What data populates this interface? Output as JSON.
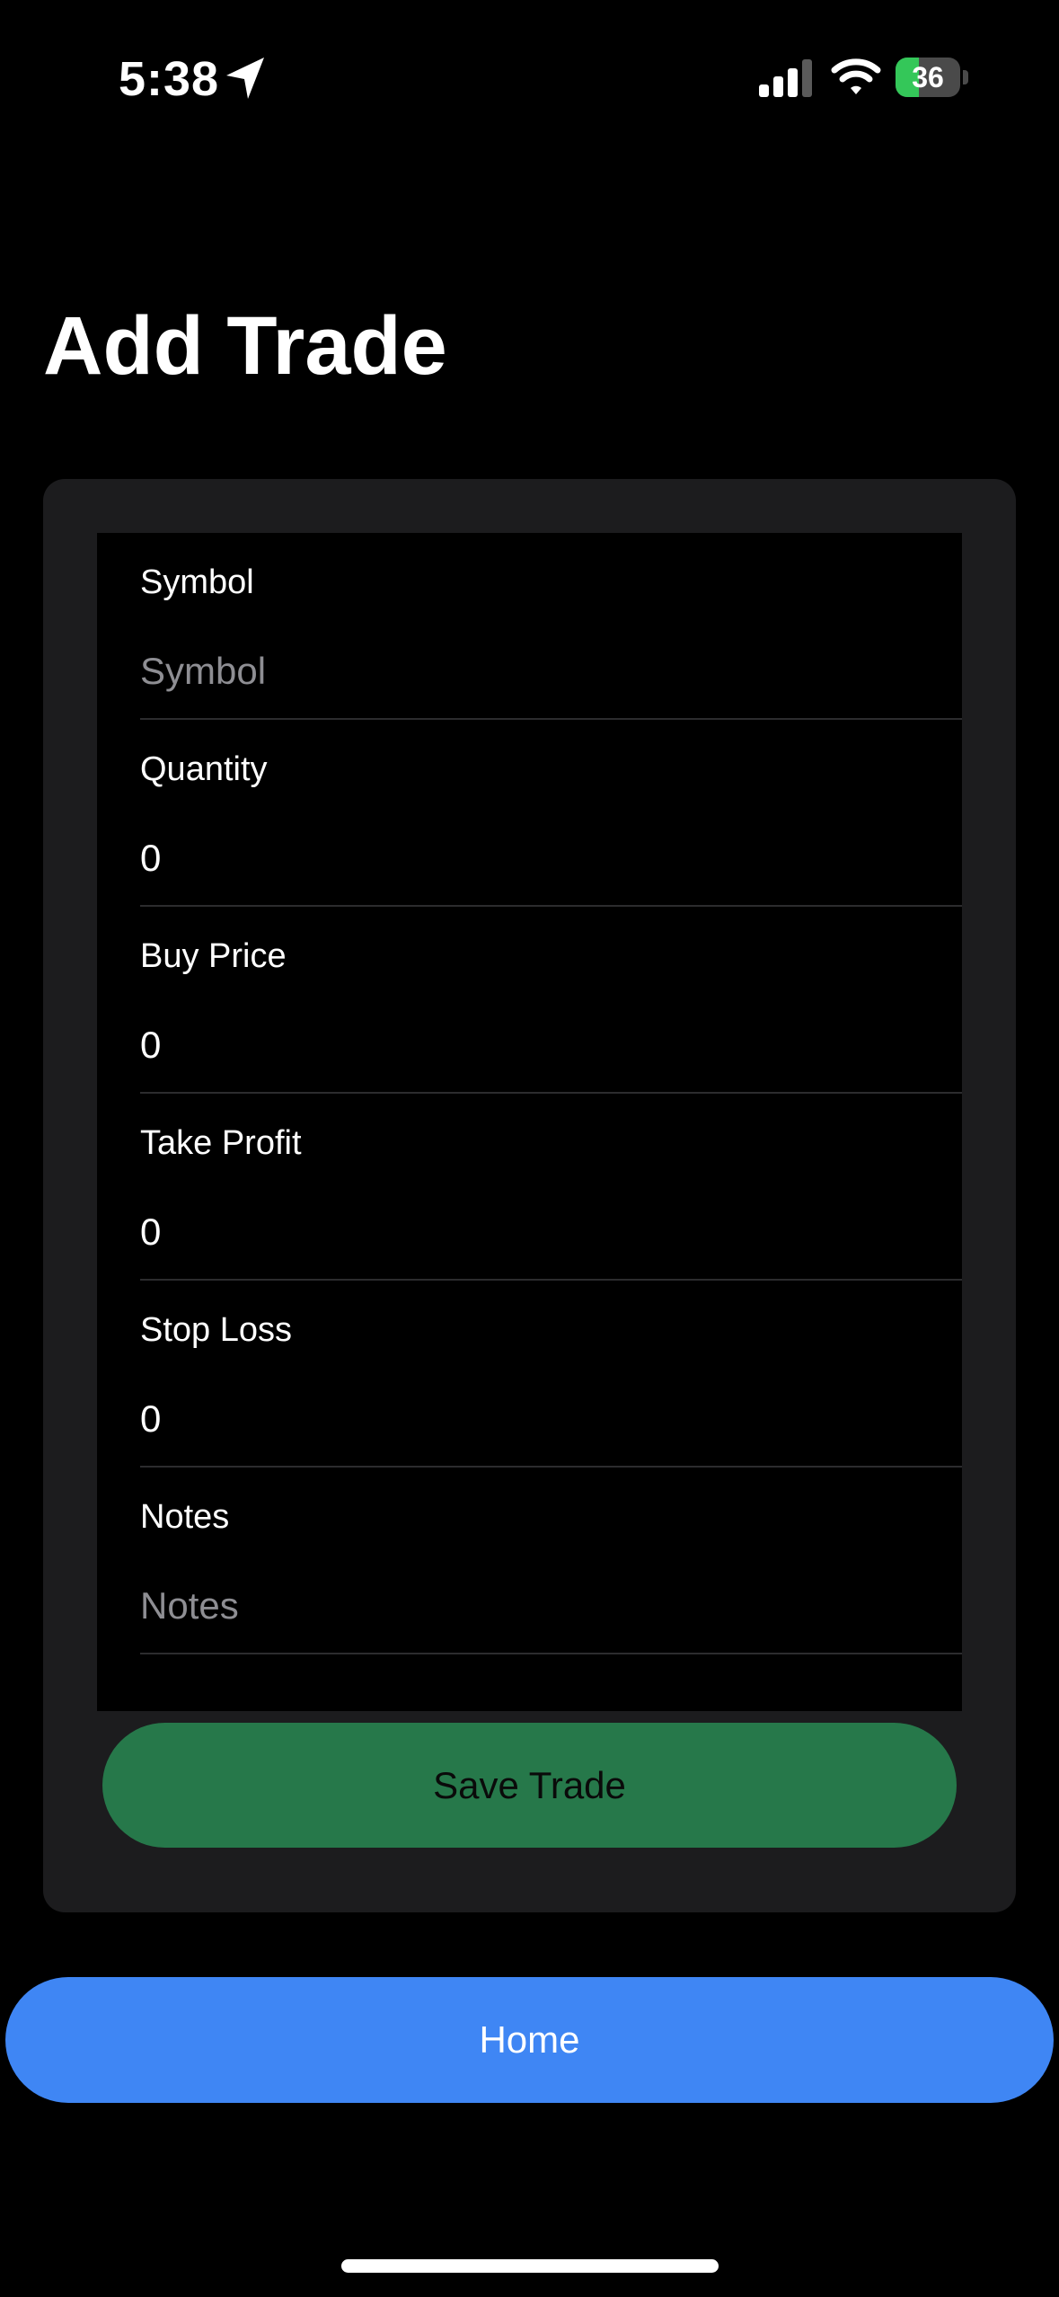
{
  "status_bar": {
    "time": "5:38",
    "battery_level": "36",
    "battery_percent": 36,
    "battery_color": "#34c759"
  },
  "page_title": "Add Trade",
  "form": {
    "fields": [
      {
        "label": "Symbol",
        "value": "",
        "placeholder": "Symbol"
      },
      {
        "label": "Quantity",
        "value": "0",
        "placeholder": ""
      },
      {
        "label": "Buy Price",
        "value": "0",
        "placeholder": ""
      },
      {
        "label": "Take Profit",
        "value": "0",
        "placeholder": ""
      },
      {
        "label": "Stop Loss",
        "value": "0",
        "placeholder": ""
      },
      {
        "label": "Notes",
        "value": "",
        "placeholder": "Notes"
      }
    ]
  },
  "buttons": {
    "save_label": "Save Trade",
    "save_color": "#26784a",
    "home_label": "Home",
    "home_color": "#3f86f4"
  },
  "icons": {
    "location": "location-arrow-icon",
    "signal": "cellular-signal-icon",
    "wifi": "wifi-icon",
    "battery": "battery-charging-icon"
  }
}
